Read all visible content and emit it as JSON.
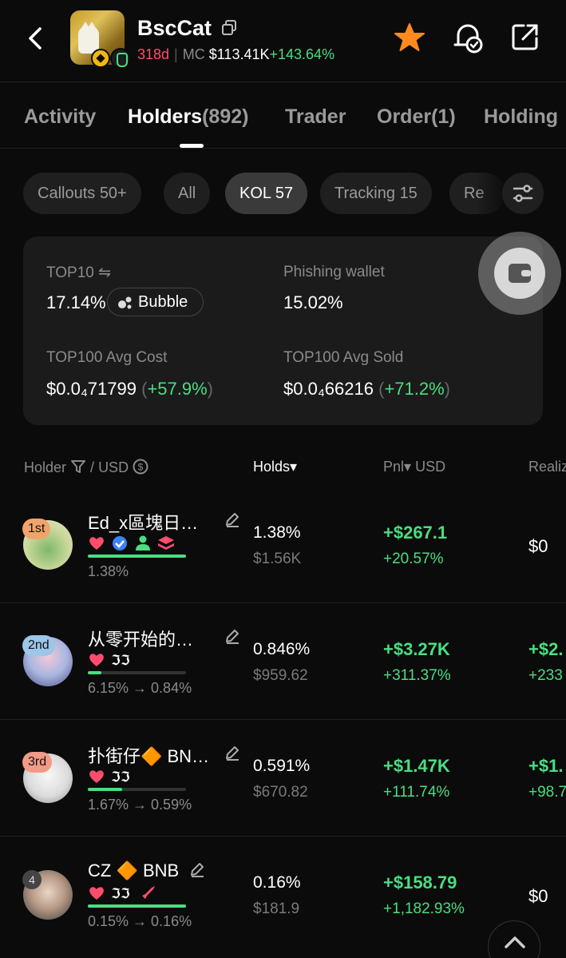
{
  "header": {
    "token_name": "BscCat",
    "age": "318d",
    "mc_label": "MC",
    "mc_value": "$113.41K",
    "mc_change": "+143.64%"
  },
  "tabs": [
    {
      "label": "Activity",
      "count": ""
    },
    {
      "label": "Holders",
      "count": "(892)"
    },
    {
      "label": "Trader",
      "count": ""
    },
    {
      "label": "Order",
      "count": "(1)"
    },
    {
      "label": "Holding",
      "count": ""
    }
  ],
  "chips": [
    "Callouts 50+",
    "All",
    "KOL 57",
    "Tracking 15",
    "Re"
  ],
  "stats": {
    "top10_label": "TOP10",
    "top10_value": "17.14%",
    "bubble_label": "Bubble",
    "phishing_label": "Phishing wallet",
    "phishing_value": "15.02%",
    "avg_cost_label": "TOP100 Avg Cost",
    "avg_cost_value": "$0.0₄71799",
    "avg_cost_change": "+57.9%",
    "avg_sold_label": "TOP100 Avg Sold",
    "avg_sold_value": "$0.0₄66216",
    "avg_sold_change": "+71.2%"
  },
  "table_header": {
    "holder": "Holder",
    "usd": "USD",
    "holds": "Holds",
    "pnl": "Pnl",
    "pnl_usd": "USD",
    "realized": "Realiz"
  },
  "rows": [
    {
      "rank": "1st",
      "name": "Ed_x區塊日…",
      "pct_line": "1.38%",
      "bar_fraction": 1.0,
      "holds_pct": "1.38%",
      "holds_usd": "$1.56K",
      "pnl_usd": "+$267.1",
      "pnl_pct": "+20.57%",
      "realized": "$0",
      "realized_pct": ""
    },
    {
      "rank": "2nd",
      "name": "从零开始的…",
      "pct_line": "6.15% → 0.84%",
      "bar_fraction": 0.14,
      "holds_pct": "0.846%",
      "holds_usd": "$959.62",
      "pnl_usd": "+$3.27K",
      "pnl_pct": "+311.37%",
      "realized": "+$2.",
      "realized_pct": "+233"
    },
    {
      "rank": "3rd",
      "name": "扑街仔🔶 BN…",
      "pct_line": "1.67% → 0.59%",
      "bar_fraction": 0.35,
      "holds_pct": "0.591%",
      "holds_usd": "$670.82",
      "pnl_usd": "+$1.47K",
      "pnl_pct": "+111.74%",
      "realized": "+$1.",
      "realized_pct": "+98.7"
    },
    {
      "rank": "4",
      "name": "CZ 🔶 BNB",
      "pct_line": "0.15% → 0.16%",
      "bar_fraction": 1.0,
      "holds_pct": "0.16%",
      "holds_usd": "$181.9",
      "pnl_usd": "+$158.79",
      "pnl_pct": "+1,182.93%",
      "realized": "$0",
      "realized_pct": ""
    }
  ],
  "colors": {
    "green": "#4ade80",
    "red": "#ff4d6d",
    "accent_star": "#ff8a1f"
  }
}
